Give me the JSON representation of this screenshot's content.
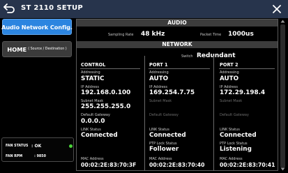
{
  "title": "ST 2110 SETUP",
  "nav": {
    "active_label": "Audio Network Config.",
    "home_label": "HOME",
    "home_sub": "( Source / Destination )"
  },
  "fan": {
    "status_label": "FAN STATUS",
    "status_value": ": OK",
    "rpm_label": "FAN RPM",
    "rpm_value": ": 9850"
  },
  "audio": {
    "heading": "AUDIO",
    "sampling_rate_label": "Sampling Rate",
    "sampling_rate_value": "48 kHz",
    "packet_time_label": "Packet Time",
    "packet_time_value": "1000us"
  },
  "network": {
    "heading": "NETWORK",
    "switch_label": "Switch",
    "switch_value": "Redundant",
    "control": {
      "heading": "CONTROL",
      "addressing_label": "Addressing",
      "addressing_value": "STATIC",
      "ip_label": "IP Address",
      "ip_value": "192.168.0.100",
      "subnet_label": "Subnet Mask",
      "subnet_value": "255.255.255.0",
      "gateway_label": "Default Gateway",
      "gateway_value": "0.0.0.0",
      "link_label": "LINK Status",
      "link_value": "Connected",
      "mac_label": "MAC Address",
      "mac_value": "00:02:2E:83:70:3F"
    },
    "port1": {
      "heading": "PORT 1",
      "addressing_label": "Addressing",
      "addressing_value": "AUTO",
      "ip_label": "IP Address",
      "ip_value": "169.254.7.75",
      "subnet_label": "Subnet Mask",
      "gateway_label": "Default Gateway",
      "link_label": "LINK Status",
      "link_value": "Connected",
      "ptp_label": "PTP Lock Status",
      "ptp_value": "Follower",
      "mac_label": "MAC Address",
      "mac_value": "00:02:2E:83:70:40"
    },
    "port2": {
      "heading": "PORT 2",
      "addressing_label": "Addressing",
      "addressing_value": "AUTO",
      "ip_label": "IP Address",
      "ip_value": "172.29.198.4",
      "subnet_label": "Subnet Mask",
      "gateway_label": "Default Gateway",
      "link_label": "LINK Status",
      "link_value": "Connected",
      "ptp_label": "PTP Lock Status",
      "ptp_value": "Listening",
      "mac_label": "MAC Address",
      "mac_value": "00:02:2E:83:70:41"
    }
  },
  "colors": {
    "titlebar": "#27344c",
    "active_nav": "#2c85e0",
    "status_ok": "#4bd43a"
  }
}
